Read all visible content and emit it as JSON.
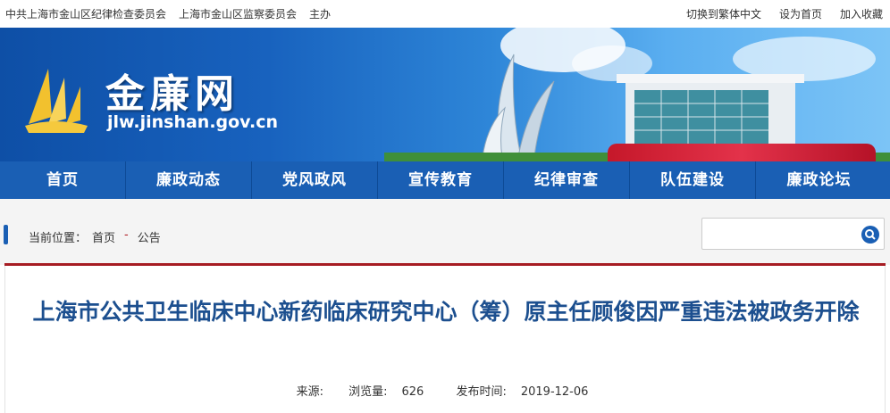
{
  "topbar": {
    "links_left": [
      "中共上海市金山区纪律检查委员会",
      "上海市金山区监察委员会",
      "主办"
    ],
    "links_right": [
      "切换到繁体中文",
      "设为首页",
      "加入收藏"
    ]
  },
  "banner": {
    "site_name": "金廉网",
    "site_url": "jlw.jinshan.gov.cn",
    "logo_icon": "sail-logo-icon"
  },
  "nav": {
    "items": [
      "首页",
      "廉政动态",
      "党风政风",
      "宣传教育",
      "纪律审查",
      "队伍建设",
      "廉政论坛"
    ]
  },
  "breadcrumb": {
    "prefix": "当前位置：",
    "home": "首页",
    "separator": "-",
    "current": "公告"
  },
  "search": {
    "placeholder": "",
    "icon": "search-icon"
  },
  "article": {
    "title": "上海市公共卫生临床中心新药临床研究中心（筹）原主任顾俊因严重违法被政务开除",
    "source_label": "来源:",
    "views_label": "浏览量:",
    "views_value": "626",
    "date_label": "发布时间:",
    "date_value": "2019-12-06"
  },
  "colors": {
    "nav_blue": "#1a5fb4",
    "title_blue": "#1c4f8f",
    "accent_red": "#a61c22"
  }
}
